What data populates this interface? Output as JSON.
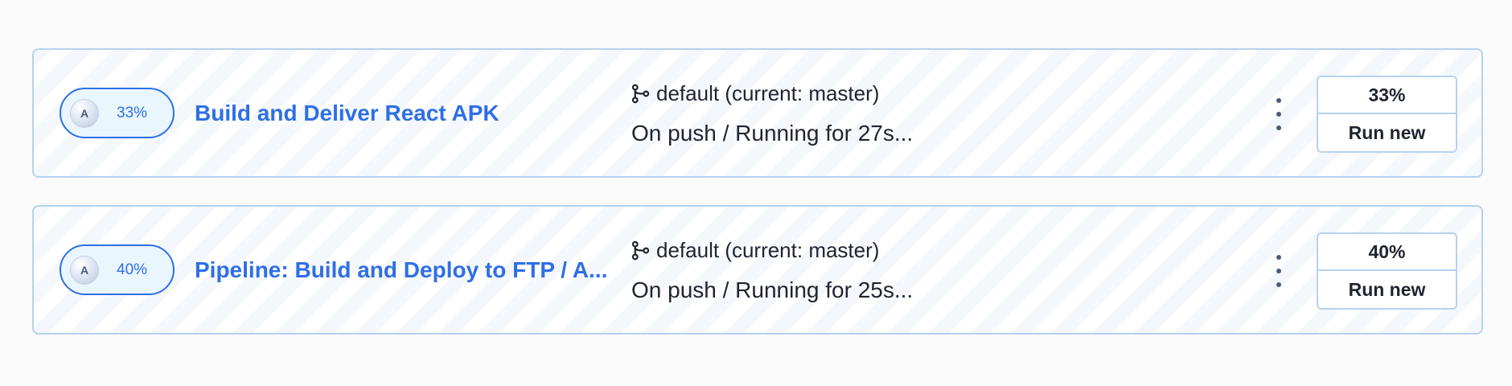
{
  "colors": {
    "accent": "#2f6fe6",
    "border": "#b6d2ef",
    "text": "#1f2430",
    "pill_bg": "#e9f6fd"
  },
  "pipelines": [
    {
      "avatar_letter": "A",
      "progress_label": "33%",
      "progress_fraction": 0.33,
      "name": "Build and Deliver React APK",
      "branch_icon": "git-branch-icon",
      "branch": "default (current: master)",
      "status": "On push / Running for 27s...",
      "more_icon": "vertical-dots-icon",
      "run_percent": "33%",
      "run_new_label": "Run new"
    },
    {
      "avatar_letter": "A",
      "progress_label": "40%",
      "progress_fraction": 0.4,
      "name": "Pipeline: Build and Deploy to FTP / A...",
      "branch_icon": "git-branch-icon",
      "branch": "default (current: master)",
      "status": "On push / Running for 25s...",
      "more_icon": "vertical-dots-icon",
      "run_percent": "40%",
      "run_new_label": "Run new"
    }
  ]
}
